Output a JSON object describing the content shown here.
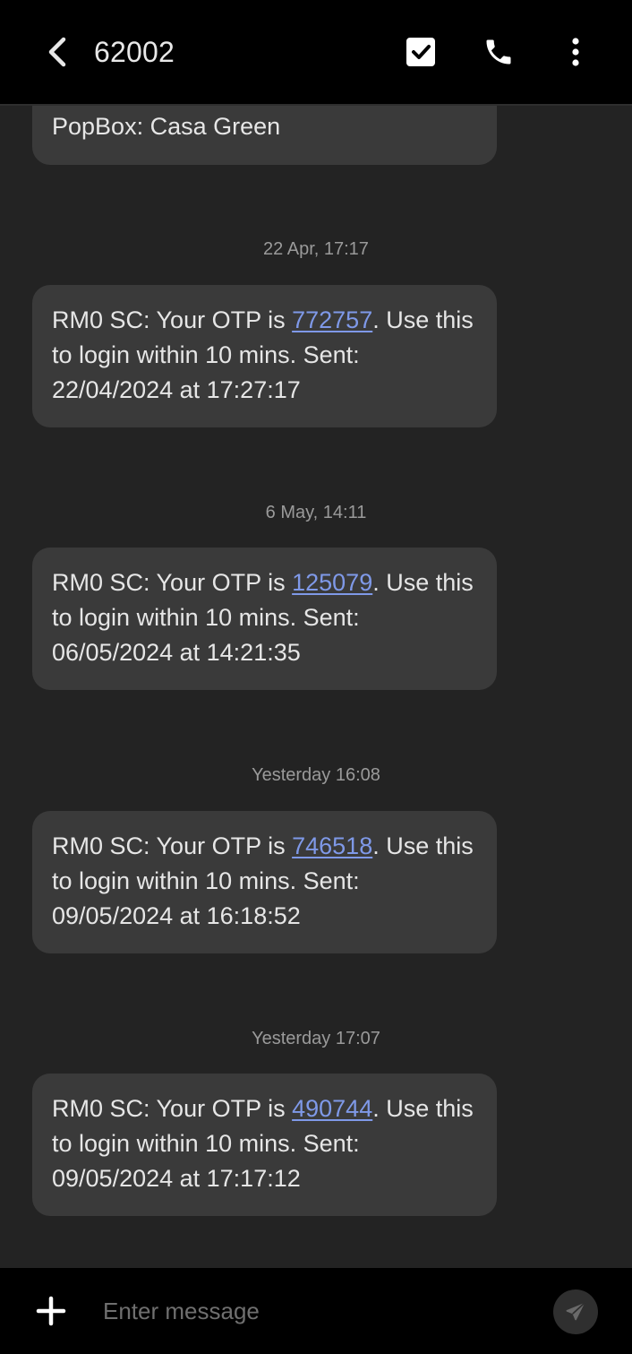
{
  "header": {
    "title": "62002",
    "icons": {
      "back": "chevron-left-icon",
      "select": "checkbox-icon",
      "call": "phone-icon",
      "more": "more-vertical-icon"
    }
  },
  "conversation": {
    "messages": [
      {
        "text_only": "PopBox: Casa Green"
      },
      {
        "timestamp": "22 Apr, 17:17",
        "prefix": "RM0 SC: Your OTP is ",
        "otp": "772757",
        "suffix": ". Use this to login within 10 mins. Sent: 22/04/2024 at 17:27:17"
      },
      {
        "timestamp": "6 May, 14:11",
        "prefix": "RM0 SC: Your OTP is ",
        "otp": "125079",
        "suffix": ". Use this to login within 10 mins. Sent: 06/05/2024 at 14:21:35"
      },
      {
        "timestamp": "Yesterday 16:08",
        "prefix": "RM0 SC: Your OTP is ",
        "otp": "746518",
        "suffix": ". Use this to login within 10 mins. Sent: 09/05/2024 at 16:18:52"
      },
      {
        "timestamp": "Yesterday 17:07",
        "prefix": "RM0 SC: Your OTP is ",
        "otp": "490744",
        "suffix": ". Use this to login within 10 mins. Sent: 09/05/2024 at 17:17:12"
      }
    ]
  },
  "composer": {
    "placeholder": "Enter message",
    "icons": {
      "add": "plus-icon",
      "send": "send-icon"
    }
  },
  "colors": {
    "background": "#232323",
    "bar": "#000000",
    "bubble": "#3a3a3a",
    "link": "#7f99e8",
    "timestamp": "#9a9a9a"
  }
}
